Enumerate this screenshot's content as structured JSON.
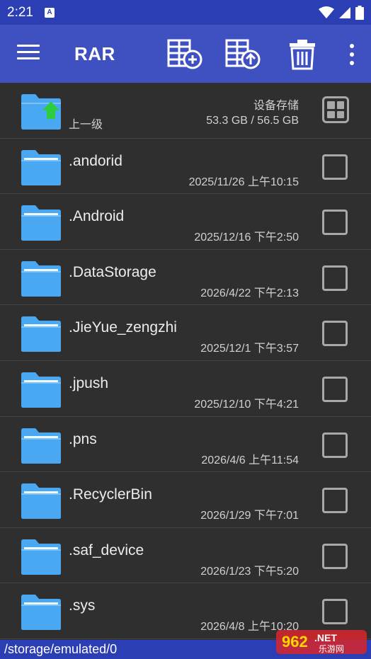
{
  "status_bar": {
    "time": "2:21",
    "notification_letter": "A"
  },
  "toolbar": {
    "title": "RAR",
    "icons": [
      "menu-icon",
      "archive-add-icon",
      "archive-extract-icon",
      "trash-icon",
      "more-vert-icon"
    ]
  },
  "up_row": {
    "label": "上一级",
    "storage_label": "设备存储",
    "storage_size": "53.3 GB / 56.5 GB"
  },
  "files": [
    {
      "name": ".andorid",
      "date": "2025/11/26 上午10:15"
    },
    {
      "name": ".Android",
      "date": "2025/12/16 下午2:50"
    },
    {
      "name": ".DataStorage",
      "date": "2026/4/22 下午2:13"
    },
    {
      "name": ".JieYue_zengzhi",
      "date": "2025/12/1 下午3:57"
    },
    {
      "name": ".jpush",
      "date": "2025/12/10 下午4:21"
    },
    {
      "name": ".pns",
      "date": "2026/4/6 上午11:54"
    },
    {
      "name": ".RecyclerBin",
      "date": "2026/1/29 下午7:01"
    },
    {
      "name": ".saf_device",
      "date": "2026/1/23 下午5:20"
    },
    {
      "name": ".sys",
      "date": "2026/4/8 上午10:20"
    }
  ],
  "path_bar": {
    "path": "/storage/emulated/0"
  },
  "watermark": {
    "number": "962",
    "suffix": ".NET",
    "text": "乐游网"
  },
  "colors": {
    "toolbar": "#3f51c0",
    "status_bar": "#2b3eb4",
    "folder": "#4aa8f2",
    "background": "#2f2f2f"
  }
}
